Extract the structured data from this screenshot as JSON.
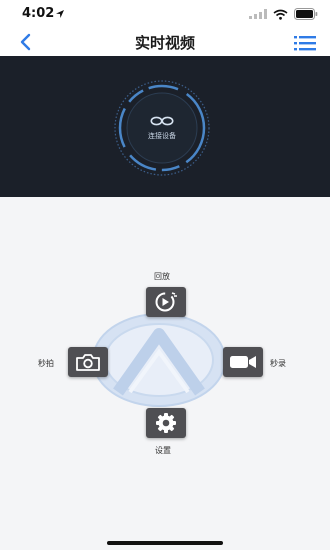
{
  "status_bar": {
    "time": "4:02"
  },
  "nav": {
    "title": "实时视频"
  },
  "video": {
    "connect_label": "连接设备"
  },
  "controls": {
    "playback_label": "回放",
    "snapshot_label": "秒拍",
    "record_label": "秒录",
    "settings_label": "设置"
  },
  "colors": {
    "accent": "#2f7be6",
    "video_bg": "#1b2029",
    "button_bg": "#4f4f53"
  }
}
